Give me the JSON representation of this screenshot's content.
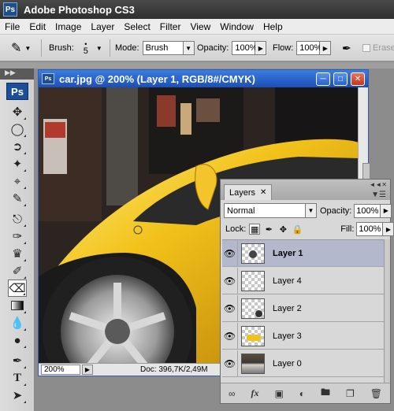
{
  "app": {
    "title": "Adobe Photoshop CS3",
    "logo": "Ps"
  },
  "menu": [
    "File",
    "Edit",
    "Image",
    "Layer",
    "Select",
    "Filter",
    "View",
    "Window",
    "Help"
  ],
  "options": {
    "brush_label": "Brush:",
    "brush_size": "5",
    "mode_label": "Mode:",
    "mode_value": "Brush",
    "opacity_label": "Opacity:",
    "opacity_value": "100%",
    "flow_label": "Flow:",
    "flow_value": "100%",
    "erase_label": "Erase"
  },
  "toolbox": {
    "logo": "Ps"
  },
  "document": {
    "title": "car.jpg @ 200% (Layer 1, RGB/8#/CMYK)",
    "zoom": "200%",
    "doc_info": "Doc: 396,7K/2,49M"
  },
  "layers_panel": {
    "tab_label": "Layers",
    "blend_mode": "Normal",
    "opacity_label": "Opacity:",
    "opacity_value": "100%",
    "lock_label": "Lock:",
    "fill_label": "Fill:",
    "fill_value": "100%",
    "layers": [
      {
        "name": "Layer 1",
        "selected": true
      },
      {
        "name": "Layer 4",
        "selected": false
      },
      {
        "name": "Layer 2",
        "selected": false
      },
      {
        "name": "Layer 3",
        "selected": false
      },
      {
        "name": "Layer 0",
        "selected": false
      }
    ]
  }
}
